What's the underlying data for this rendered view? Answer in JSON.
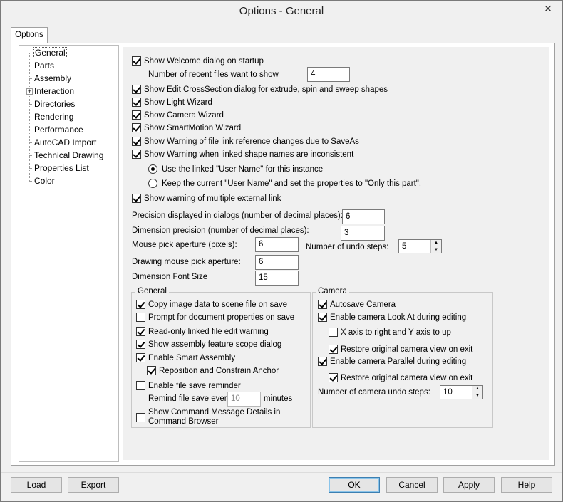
{
  "window": {
    "title": "Options - General",
    "close_glyph": "✕"
  },
  "tab": {
    "label": "Options"
  },
  "tree": {
    "items": [
      {
        "label": "General",
        "selected": true
      },
      {
        "label": "Parts"
      },
      {
        "label": "Assembly"
      },
      {
        "label": "Interaction",
        "expandable": true
      },
      {
        "label": "Directories"
      },
      {
        "label": "Rendering"
      },
      {
        "label": "Performance"
      },
      {
        "label": "AutoCAD Import"
      },
      {
        "label": "Technical Drawing"
      },
      {
        "label": "Properties List"
      },
      {
        "label": "Color"
      }
    ],
    "expander_glyph": "+"
  },
  "options": {
    "welcome": "Show Welcome dialog on startup",
    "recent_files_label": "Number of recent files want to show",
    "recent_files_value": "4",
    "crosssection": "Show Edit CrossSection dialog for extrude, spin and sweep shapes",
    "light_wizard": "Show Light Wizard",
    "camera_wizard": "Show Camera Wizard",
    "smartmotion_wizard": "Show SmartMotion Wizard",
    "file_link_warning": "Show Warning of file link reference changes due to SaveAs",
    "linked_names_warning": "Show Warning when linked shape names are inconsistent",
    "radio_use_linked": "Use the linked \"User Name\" for this instance",
    "radio_keep_current": "Keep the current \"User Name\" and set the properties to \"Only this part\".",
    "external_link_warning": "Show warning of multiple external link"
  },
  "precision": {
    "dialog_label": "Precision displayed in dialogs (number of decimal places):",
    "dialog_value": "6",
    "dimension_label": "Dimension precision (number of decimal places):",
    "dimension_value": "3",
    "mouse_label": "Mouse pick aperture (pixels):",
    "mouse_value": "6",
    "undo_label": "Number of undo steps:",
    "undo_value": "5",
    "drawing_label": "Drawing mouse pick aperture:",
    "drawing_value": "6",
    "font_label": "Dimension Font Size",
    "font_value": "15"
  },
  "general_group": {
    "title": "General",
    "copy_image": "Copy image data to scene file on save",
    "prompt_props": "Prompt for document properties on save",
    "readonly_warning": "Read-only linked file edit warning",
    "feature_scope": "Show assembly feature scope dialog",
    "smart_assembly": "Enable Smart Assembly",
    "reposition": "Reposition and Constrain Anchor",
    "save_reminder": "Enable file save reminder",
    "remind_prefix": "Remind file save every",
    "remind_value": "10",
    "remind_suffix": "minutes",
    "command_details_1": "Show Command Message Details in",
    "command_details_2": "Command Browser"
  },
  "camera_group": {
    "title": "Camera",
    "autosave": "Autosave Camera",
    "look_at": "Enable camera Look At during editing",
    "xy_axis": "X axis to right and Y axis to up",
    "restore_1": "Restore original camera view on exit",
    "parallel": "Enable camera Parallel during editing",
    "restore_2": "Restore original camera view on exit",
    "undo_label": "Number of camera undo steps:",
    "undo_value": "10"
  },
  "buttons": {
    "load": "Load",
    "export": "Export",
    "ok": "OK",
    "cancel": "Cancel",
    "apply": "Apply",
    "help": "Help"
  },
  "spin_glyphs": {
    "up": "▲",
    "down": "▼"
  }
}
